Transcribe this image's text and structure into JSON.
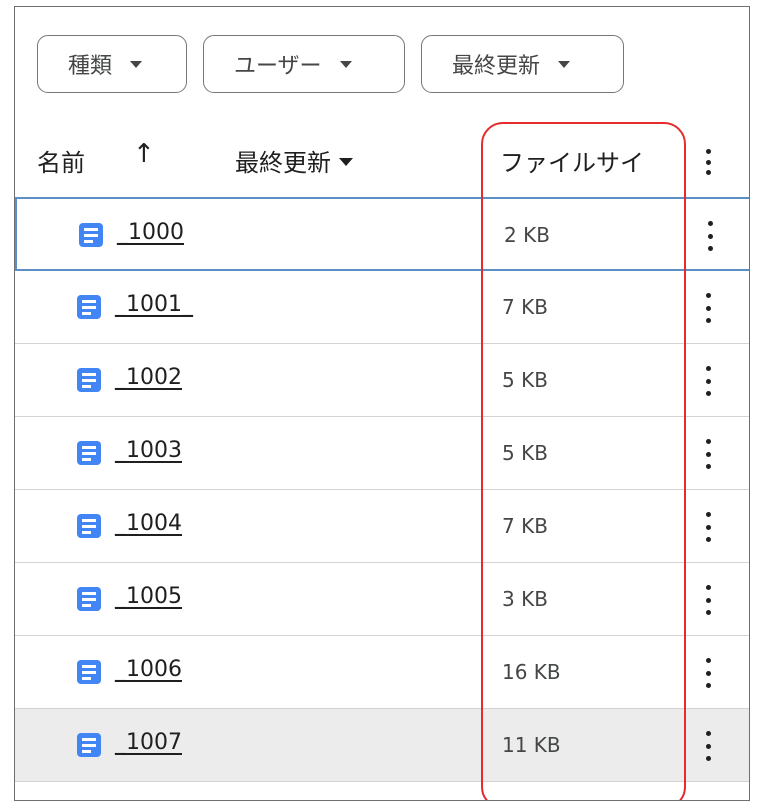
{
  "filters": {
    "type_label": "種類",
    "user_label": "ユーザー",
    "modified_label": "最終更新"
  },
  "header": {
    "name_label": "名前",
    "sort_arrow": "↑",
    "modified_label": "最終更新",
    "size_label": "ファイルサイ"
  },
  "rows": [
    {
      "name": "_1000",
      "size": "2 KB"
    },
    {
      "name": "_1001_",
      "size": "7 KB"
    },
    {
      "name": "_1002",
      "size": "5 KB"
    },
    {
      "name": "_1003",
      "size": "5 KB"
    },
    {
      "name": "_1004",
      "size": "7 KB"
    },
    {
      "name": "_1005",
      "size": "3 KB"
    },
    {
      "name": "_1006",
      "size": "16 KB"
    },
    {
      "name": "_1007",
      "size": "11 KB"
    }
  ],
  "colors": {
    "doc_icon": "#4285f4",
    "highlight": "#e52b2b",
    "selected_border": "#5b8fc7"
  },
  "icons": {
    "file": "google-docs-icon",
    "more": "more-vert-icon",
    "dropdown": "caret-down-icon",
    "sort": "arrow-up-icon"
  }
}
